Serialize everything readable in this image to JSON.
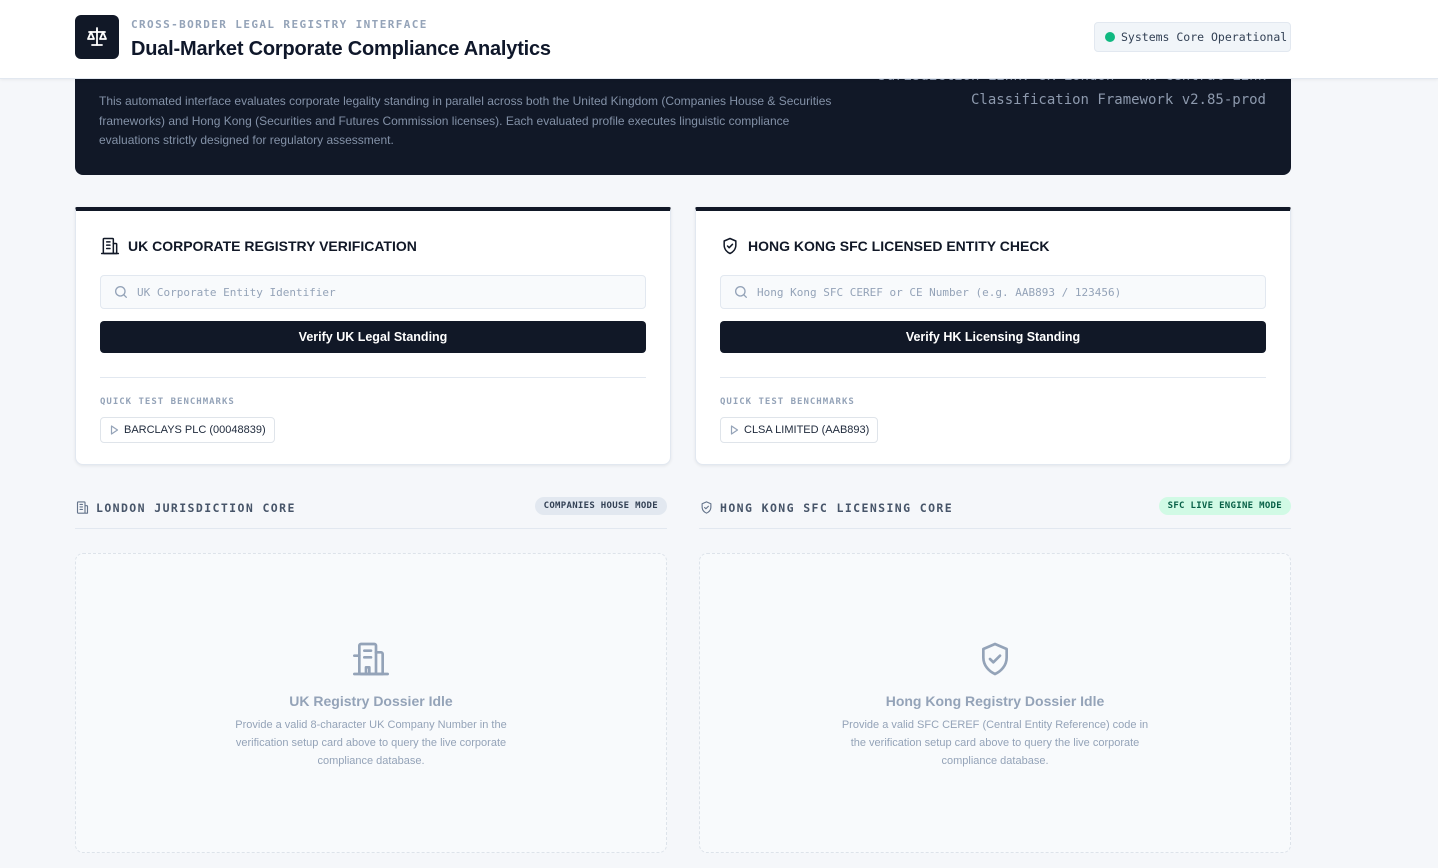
{
  "header": {
    "eyebrow": "CROSS-BORDER LEGAL REGISTRY INTERFACE",
    "title": "Dual-Market Corporate Compliance Analytics",
    "status": "Systems Core Operational",
    "logo_icon": "scales-icon"
  },
  "hero": {
    "description": "This automated interface evaluates corporate legality standing in parallel across both the United Kingdom (Companies House & Securities frameworks) and Hong Kong (Securities and Futures Commission licenses). Each evaluated profile executes linguistic compliance evaluations strictly designed for regulatory assessment.",
    "meta_line1": "Jurisdiction Link: UK London · HK Central Link",
    "meta_line2": "Classification Framework v2.85-prod"
  },
  "uk_card": {
    "title": "UK CORPORATE REGISTRY VERIFICATION",
    "search_placeholder": "UK Corporate Entity Identifier",
    "search_value": "",
    "button_label": "Verify UK Legal Standing",
    "benchmarks_label": "QUICK TEST BENCHMARKS",
    "benchmark": "BARCLAYS PLC (00048839)",
    "icon": "building-icon"
  },
  "hk_card": {
    "title": "HONG KONG SFC LICENSED ENTITY CHECK",
    "search_placeholder": "Hong Kong SFC CEREF or CE Number (e.g. AAB893 / 123456)",
    "search_value": "",
    "button_label": "Verify HK Licensing Standing",
    "benchmarks_label": "QUICK TEST BENCHMARKS",
    "benchmark": "CLSA LIMITED (AAB893)",
    "icon": "shield-check-icon"
  },
  "uk_section": {
    "title": "LONDON JURISDICTION CORE",
    "badge": "COMPANIES HOUSE MODE",
    "idle_title": "UK Registry Dossier Idle",
    "idle_desc": "Provide a valid 8-character UK Company Number in the verification setup card above to query the live corporate compliance database."
  },
  "hk_section": {
    "title": "HONG KONG SFC LICENSING CORE",
    "badge": "SFC LIVE ENGINE MODE",
    "idle_title": "Hong Kong Registry Dossier Idle",
    "idle_desc": "Provide a valid SFC CEREF (Central Entity Reference) code in the verification setup card above to query the live corporate compliance database."
  },
  "colors": {
    "primary_dark": "#111827",
    "status_green": "#10b981",
    "badge_green_bg": "#d1fae5",
    "background": "#f5f7fa"
  }
}
